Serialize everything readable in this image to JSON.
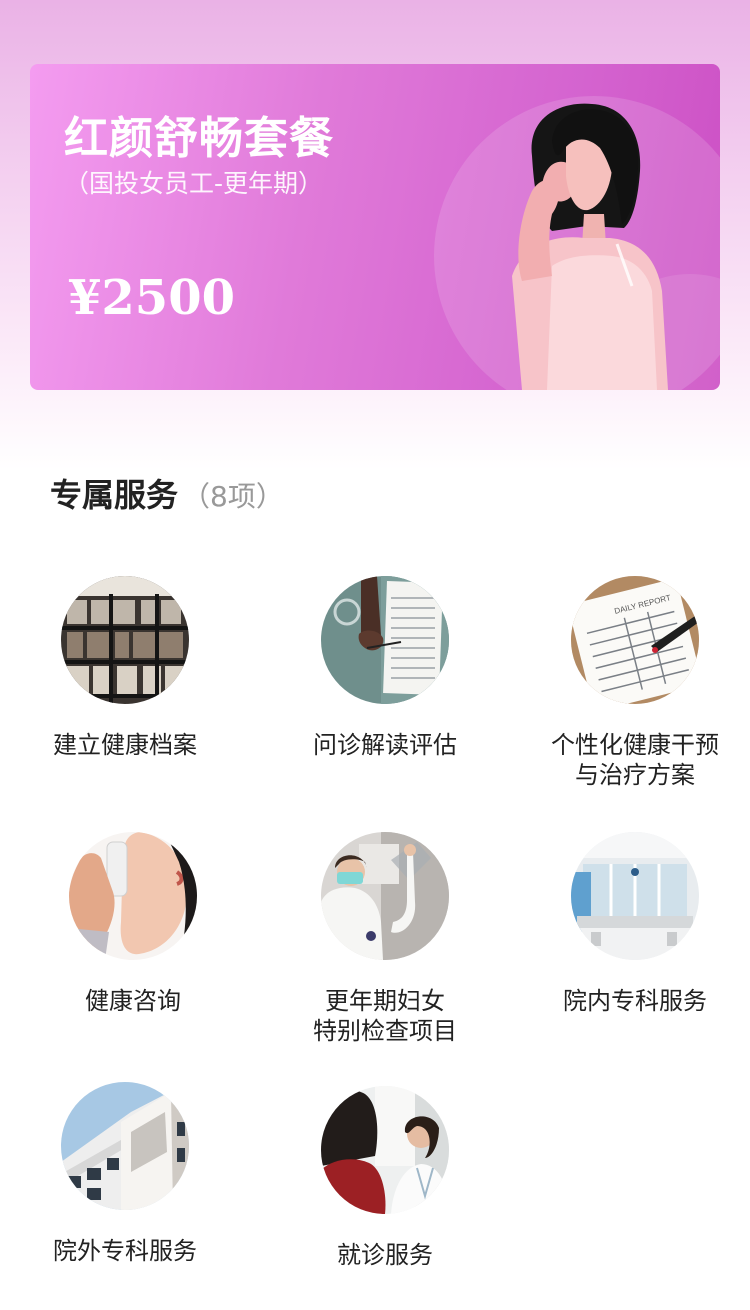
{
  "banner": {
    "title": "红颜舒畅套餐",
    "subtitle": "（国投女员工-更年期）",
    "price": "¥2500"
  },
  "section": {
    "title": "专属服务",
    "count": "（8项）"
  },
  "services": [
    {
      "label": "建立健康档案",
      "icon": "archive-shelves-photo"
    },
    {
      "label": "问诊解读评估",
      "icon": "report-reading-photo"
    },
    {
      "label_line1": "个性化健康干预",
      "label_line2": "与治疗方案",
      "icon": "daily-report-clipboard-photo"
    },
    {
      "label": "健康咨询",
      "icon": "phone-call-photo"
    },
    {
      "label_line1": "更年期妇女",
      "label_line2": "特别检查项目",
      "icon": "doctor-xray-photo"
    },
    {
      "label": "院内专科服务",
      "icon": "hospital-reception-photo"
    },
    {
      "label": "院外专科服务",
      "icon": "building-exterior-photo"
    },
    {
      "label": "就诊服务",
      "icon": "doctor-patient-photo"
    }
  ],
  "colors": {
    "banner_start": "#f49cf0",
    "banner_end": "#cc4fc4",
    "page_top": "#eab2e6",
    "text_primary": "#222222",
    "text_muted": "#999999"
  }
}
